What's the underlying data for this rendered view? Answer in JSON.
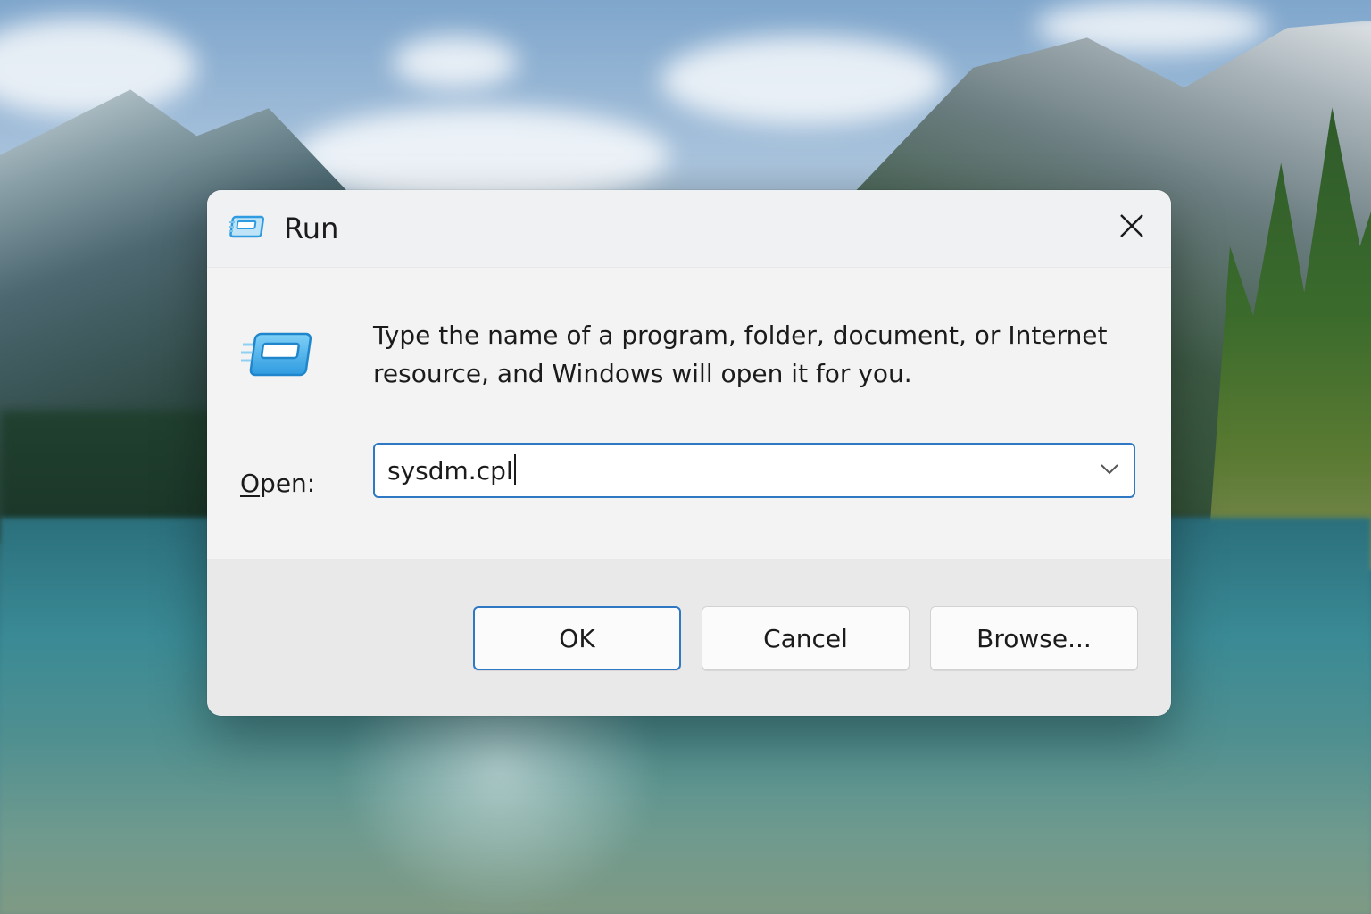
{
  "dialog": {
    "title": "Run",
    "close_icon": "close-icon",
    "app_icon": "run-icon",
    "description": "Type the name of a program, folder, document, or Internet resource, and Windows will open it for you.",
    "open_label_accesskey": "O",
    "open_label_rest": "pen:",
    "open_value": "sysdm.cpl",
    "dropdown_icon": "chevron-down-icon",
    "buttons": {
      "ok": "OK",
      "cancel": "Cancel",
      "browse": "Browse..."
    }
  },
  "colors": {
    "accent": "#2f78c4",
    "dialog_bg": "#f3f3f3",
    "footer_bg": "#e9e9ea",
    "icon_blue": "#2f9be0"
  }
}
